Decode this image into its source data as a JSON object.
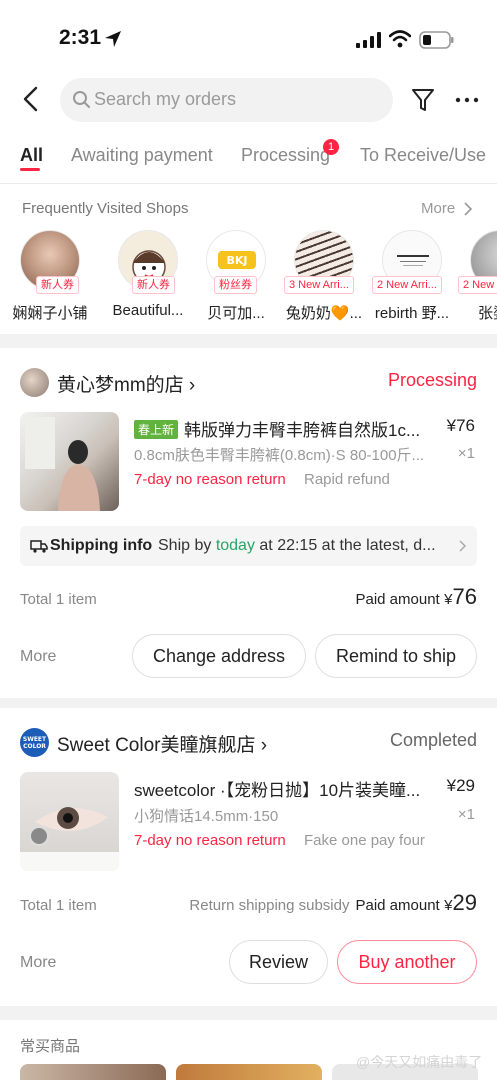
{
  "status": {
    "time": "2:31"
  },
  "search": {
    "placeholder": "Search my orders"
  },
  "tabs": [
    {
      "label": "All"
    },
    {
      "label": "Awaiting payment"
    },
    {
      "label": "Processing",
      "badge": "1"
    },
    {
      "label": "To Receive/Use"
    }
  ],
  "shops": {
    "title": "Frequently Visited Shops",
    "more": "More",
    "items": [
      {
        "name": "娴娴子小铺",
        "tag": "新人券"
      },
      {
        "name": "Beautiful...",
        "tag": "新人券"
      },
      {
        "name": "贝可加...",
        "tag": "粉丝券"
      },
      {
        "name": "兔奶奶🧡...",
        "tag": "3 New Arri..."
      },
      {
        "name": "rebirth 野...",
        "tag": "2 New Arri..."
      },
      {
        "name": "张婆",
        "tag": "2 New"
      }
    ]
  },
  "order1": {
    "store": "黄心梦mm的店",
    "status": "Processing",
    "badge": "春上新",
    "title": "韩版弹力丰臀丰胯裤自然版1c...",
    "price": "¥76",
    "spec": "0.8cm肤色丰臀丰胯裤(0.8cm)·S 80-100斤...",
    "qty": "×1",
    "return": "7-day no reason return",
    "refund": "Rapid refund",
    "ship_label": "Shipping info",
    "ship_pre": "Ship by ",
    "ship_today": "today",
    "ship_post": " at 22:15 at the latest, d...",
    "total": "Total 1 item",
    "paid_label": "Paid amount",
    "paid_cur": "¥",
    "paid_num": "76",
    "more": "More",
    "btn1": "Change address",
    "btn2": "Remind to ship"
  },
  "order2": {
    "store": "Sweet Color美瞳旗舰店",
    "status": "Completed",
    "title": "sweetcolor ·【宠粉日抛】10片装美瞳...",
    "price": "¥29",
    "spec": "小狗情话14.5mm·150",
    "qty": "×1",
    "return": "7-day no reason return",
    "refund": "Fake one pay four",
    "total": "Total 1 item",
    "subsidy": "Return shipping subsidy",
    "paid_label": "Paid amount",
    "paid_cur": "¥",
    "paid_num": "29",
    "more": "More",
    "btn1": "Review",
    "btn2": "Buy another"
  },
  "bottom": {
    "title": "常买商品"
  },
  "watermark": "@今天又如痛由毒了",
  "colors": {
    "accent": "#ff2442",
    "green": "#27a567",
    "badge_green": "#62b33e"
  }
}
